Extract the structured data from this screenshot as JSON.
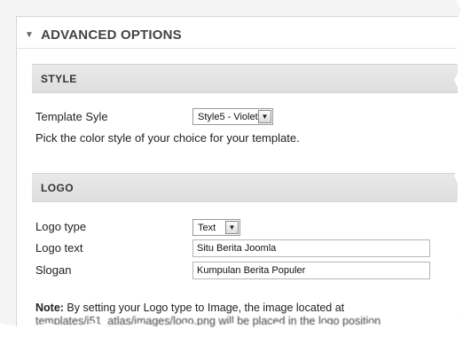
{
  "advanced_options": {
    "title": "ADVANCED OPTIONS"
  },
  "style_section": {
    "title": "STYLE",
    "template_style_label": "Template Syle",
    "template_style_value": "Style5 - Violet",
    "help_text": "Pick the color style of your choice for your template."
  },
  "logo_section": {
    "title": "LOGO",
    "logo_type_label": "Logo type",
    "logo_type_value": "Text",
    "logo_text_label": "Logo text",
    "logo_text_value": "Situ Berita Joomla",
    "slogan_label": "Slogan",
    "slogan_value": "Kumpulan Berita Populer",
    "note_label": "Note:",
    "note_text": " By setting your Logo type to Image, the image located at",
    "note_path": "templates/j51_atlas/images/logo.png will be placed in the logo position"
  },
  "icons": {
    "collapse": "triangle-down-icon",
    "dropdown": "chevron-down-icon"
  }
}
